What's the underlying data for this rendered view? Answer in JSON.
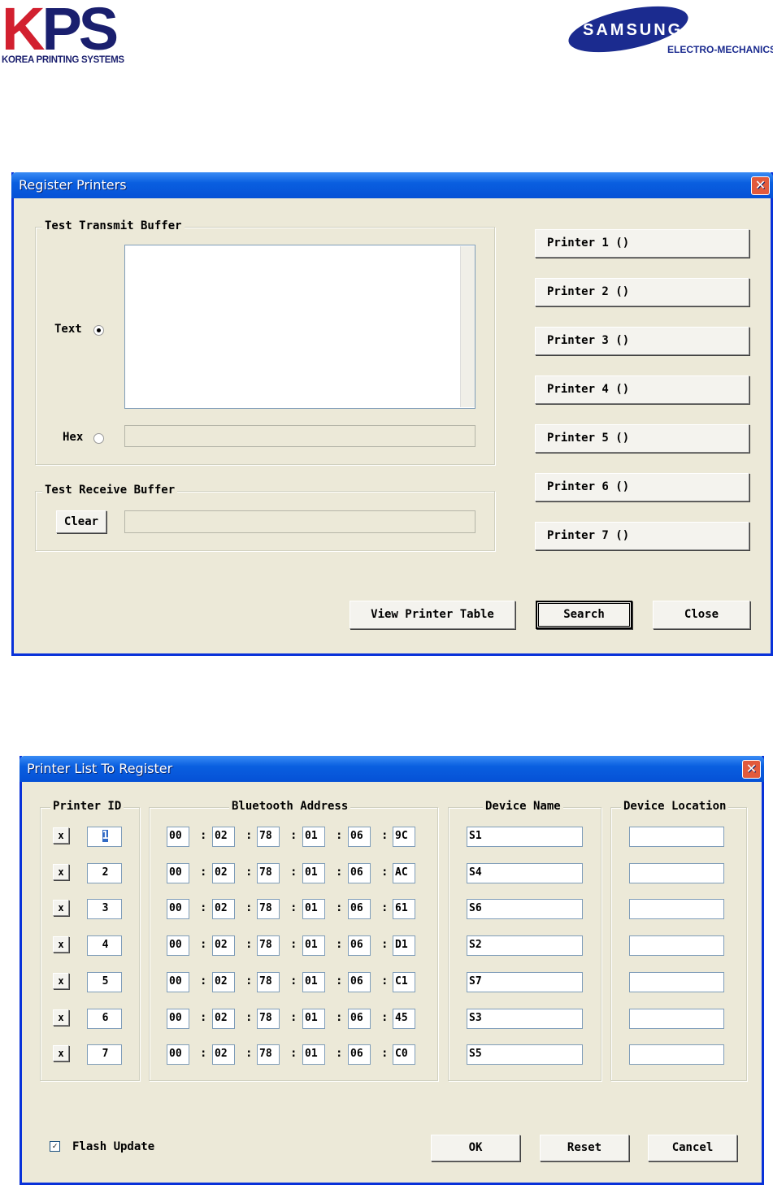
{
  "logos": {
    "kps": "KPS",
    "kps_sub": "KOREA PRINTING SYSTEMS",
    "samsung": "SAMSUNG",
    "samsung_sub": "ELECTRO-MECHANICS"
  },
  "register": {
    "title": "Register Printers",
    "close_glyph": "✕",
    "transmit_group": "Test Transmit Buffer",
    "text_label": "Text",
    "text_selected": true,
    "hex_label": "Hex",
    "text_value": "",
    "hex_value": "",
    "receive_group": "Test Receive Buffer",
    "clear": "Clear",
    "receive_value": "",
    "printers": [
      "Printer 1 ()",
      "Printer 2 ()",
      "Printer 3 ()",
      "Printer 4 ()",
      "Printer 5 ()",
      "Printer 6 ()",
      "Printer 7 ()"
    ],
    "view_table": "View Printer Table",
    "search": "Search",
    "close": "Close"
  },
  "list": {
    "title": "Printer List To Register",
    "close_glyph": "✕",
    "headers": {
      "id": "Printer ID",
      "bt": "Bluetooth Address",
      "name": "Device Name",
      "loc": "Device Location"
    },
    "check_glyph": "x",
    "rows": [
      {
        "id": "1",
        "addr": [
          "00",
          "02",
          "78",
          "01",
          "06",
          "9C"
        ],
        "name": "S1",
        "loc": ""
      },
      {
        "id": "2",
        "addr": [
          "00",
          "02",
          "78",
          "01",
          "06",
          "AC"
        ],
        "name": "S4",
        "loc": ""
      },
      {
        "id": "3",
        "addr": [
          "00",
          "02",
          "78",
          "01",
          "06",
          "61"
        ],
        "name": "S6",
        "loc": ""
      },
      {
        "id": "4",
        "addr": [
          "00",
          "02",
          "78",
          "01",
          "06",
          "D1"
        ],
        "name": "S2",
        "loc": ""
      },
      {
        "id": "5",
        "addr": [
          "00",
          "02",
          "78",
          "01",
          "06",
          "C1"
        ],
        "name": "S7",
        "loc": ""
      },
      {
        "id": "6",
        "addr": [
          "00",
          "02",
          "78",
          "01",
          "06",
          "45"
        ],
        "name": "S3",
        "loc": ""
      },
      {
        "id": "7",
        "addr": [
          "00",
          "02",
          "78",
          "01",
          "06",
          "C0"
        ],
        "name": "S5",
        "loc": ""
      }
    ],
    "separator": ":",
    "flash_label": "Flash Update",
    "flash_checked": true,
    "ok": "OK",
    "reset": "Reset",
    "cancel": "Cancel"
  }
}
